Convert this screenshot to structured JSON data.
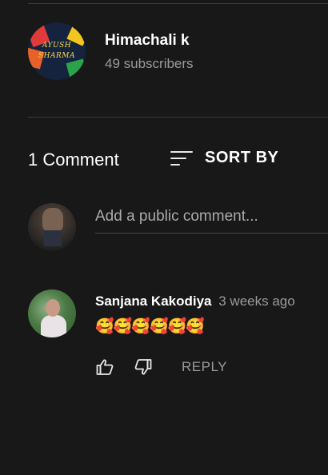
{
  "channel": {
    "avatar_text_line1": "AYUSH",
    "avatar_text_line2": "SHARMA",
    "name": "Himachali k",
    "subscribers": "49 subscribers"
  },
  "comments_section": {
    "count_label": "1 Comment",
    "sort_label": "SORT BY",
    "add_comment_placeholder": "Add a public comment..."
  },
  "comments": [
    {
      "author": "Sanjana Kakodiya",
      "time": "3 weeks ago",
      "text": "🥰🥰🥰🥰🥰🥰",
      "reply_label": "REPLY"
    }
  ],
  "icons": {
    "sort": "sort-icon",
    "like": "thumbs-up-icon",
    "dislike": "thumbs-down-icon"
  },
  "colors": {
    "background": "#181818",
    "primary_text": "#ffffff",
    "secondary_text": "#9a9a9a",
    "divider": "#3a3a3a"
  }
}
